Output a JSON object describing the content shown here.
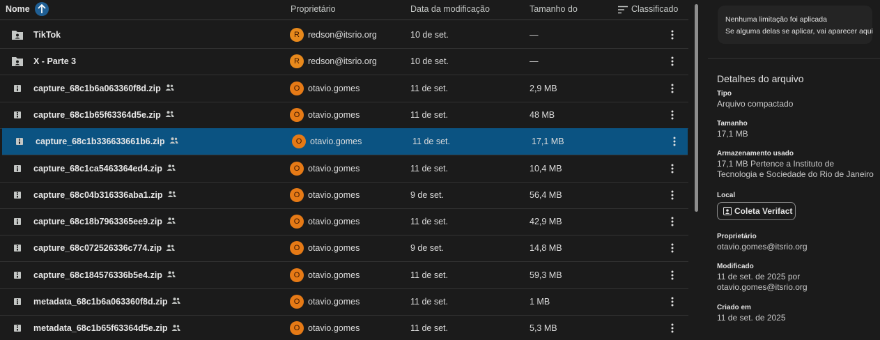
{
  "header": {
    "name_label": "Nome",
    "owner_label": "Proprietário",
    "modified_label": "Data da modificação",
    "size_label": "Tamanho do",
    "sort_label": "Classificado"
  },
  "files": [
    {
      "name": "TikTok",
      "type": "shared-folder",
      "shared": false,
      "owner_initial": "R",
      "owner": "redson@itsrio.org",
      "modified": "10 de set.",
      "size": "—"
    },
    {
      "name": "X - Parte 3",
      "type": "shared-folder",
      "shared": false,
      "owner_initial": "R",
      "owner": "redson@itsrio.org",
      "modified": "10 de set.",
      "size": "—"
    },
    {
      "name": "capture_68c1b6a063360f8d.zip",
      "type": "zip",
      "shared": true,
      "owner_initial": "O",
      "owner": "otavio.gomes",
      "modified": "11 de set.",
      "size": "2,9 MB"
    },
    {
      "name": "capture_68c1b65f63364d5e.zip",
      "type": "zip",
      "shared": true,
      "owner_initial": "O",
      "owner": "otavio.gomes",
      "modified": "11 de set.",
      "size": "48 MB"
    },
    {
      "name": "capture_68c1b336633661b6.zip",
      "type": "zip",
      "shared": true,
      "owner_initial": "O",
      "owner": "otavio.gomes",
      "modified": "11 de set.",
      "size": "17,1 MB",
      "selected": true
    },
    {
      "name": "capture_68c1ca5463364ed4.zip",
      "type": "zip",
      "shared": true,
      "owner_initial": "O",
      "owner": "otavio.gomes",
      "modified": "11 de set.",
      "size": "10,4 MB"
    },
    {
      "name": "capture_68c04b316336aba1.zip",
      "type": "zip",
      "shared": true,
      "owner_initial": "O",
      "owner": "otavio.gomes",
      "modified": "9 de set.",
      "size": "56,4 MB"
    },
    {
      "name": "capture_68c18b7963365ee9.zip",
      "type": "zip",
      "shared": true,
      "owner_initial": "O",
      "owner": "otavio.gomes",
      "modified": "11 de set.",
      "size": "42,9 MB"
    },
    {
      "name": "capture_68c072526336c774.zip",
      "type": "zip",
      "shared": true,
      "owner_initial": "O",
      "owner": "otavio.gomes",
      "modified": "9 de set.",
      "size": "14,8 MB"
    },
    {
      "name": "capture_68c184576336b5e4.zip",
      "type": "zip",
      "shared": true,
      "owner_initial": "O",
      "owner": "otavio.gomes",
      "modified": "11 de set.",
      "size": "59,3 MB"
    },
    {
      "name": "metadata_68c1b6a063360f8d.zip",
      "type": "zip",
      "shared": true,
      "owner_initial": "O",
      "owner": "otavio.gomes",
      "modified": "11 de set.",
      "size": "1 MB"
    },
    {
      "name": "metadata_68c1b65f63364d5e.zip",
      "type": "zip",
      "shared": true,
      "owner_initial": "O",
      "owner": "otavio.gomes",
      "modified": "11 de set.",
      "size": "5,3 MB"
    }
  ],
  "notice": {
    "title": "Nenhuma limitação foi aplicada",
    "body": "Se alguma delas se aplicar, vai aparecer aqui"
  },
  "details": {
    "title": "Detalhes do arquivo",
    "type_label": "Tipo",
    "type_value": "Arquivo compactado",
    "size_label": "Tamanho",
    "size_value": "17,1 MB",
    "storage_label": "Armazenamento usado",
    "storage_value": "17,1 MB Pertence a Instituto de Tecnologia e Sociedade do Rio de Janeiro",
    "location_label": "Local",
    "location_value": "Coleta Verifact",
    "owner_label": "Proprietário",
    "owner_value": "otavio.gomes@itsrio.org",
    "modified_label": "Modificado",
    "modified_value": "11 de set. de 2025 por otavio.gomes@itsrio.org",
    "created_label": "Criado em",
    "created_value": "11 de set. de 2025"
  },
  "colors": {
    "selected_row": "#0b5382",
    "avatar_r": "#e8891c",
    "avatar_o": "#e67a16",
    "sort_circle": "#1f5f94"
  }
}
